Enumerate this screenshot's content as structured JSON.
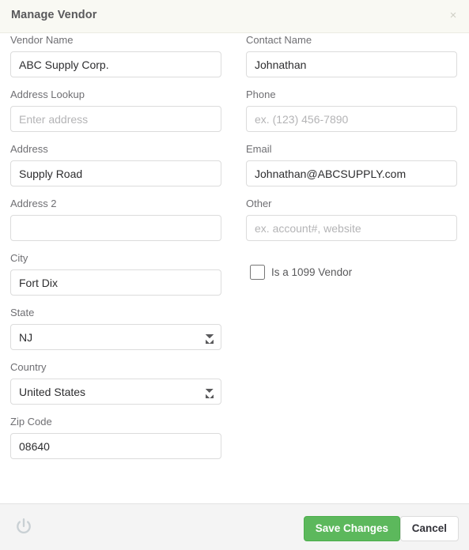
{
  "header": {
    "title": "Manage Vendor",
    "close_label": "×"
  },
  "form": {
    "left_column": [
      {
        "label": "Vendor Name",
        "type": "text",
        "value": "ABC Supply Corp.",
        "placeholder": ""
      },
      {
        "label": "Address Lookup",
        "type": "text",
        "value": "",
        "placeholder": "Enter address"
      },
      {
        "label": "Address",
        "type": "text",
        "value": "Supply Road",
        "placeholder": ""
      },
      {
        "label": "Address 2",
        "type": "text",
        "value": "",
        "placeholder": ""
      },
      {
        "label": "City",
        "type": "text",
        "value": "Fort Dix",
        "placeholder": ""
      },
      {
        "label": "State",
        "type": "select",
        "value": "NJ",
        "placeholder": ""
      },
      {
        "label": "Country",
        "type": "select",
        "value": "United States",
        "placeholder": ""
      },
      {
        "label": "Zip Code",
        "type": "text",
        "value": "08640",
        "placeholder": ""
      }
    ],
    "right_column": [
      {
        "label": "Contact Name",
        "type": "text",
        "value": "Johnathan",
        "placeholder": ""
      },
      {
        "label": "Phone",
        "type": "text",
        "value": "",
        "placeholder": "ex. (123) 456-7890"
      },
      {
        "label": "Email",
        "type": "text",
        "value": "Johnathan@ABCSUPPLY.com",
        "placeholder": ""
      },
      {
        "label": "Other",
        "type": "text",
        "value": "",
        "placeholder": "ex. account#, website"
      }
    ],
    "checkbox": {
      "label": "Is a 1099 Vendor",
      "checked": false
    }
  },
  "footer": {
    "power_icon": "power-icon",
    "save_label": "Save Changes",
    "cancel_label": "Cancel"
  },
  "colors": {
    "header_bg": "#f9f9f3",
    "footer_bg": "#f4f4f4",
    "save_green": "#5cb85c",
    "label_text": "#6f6f73",
    "placeholder": "#b4b4b6"
  }
}
